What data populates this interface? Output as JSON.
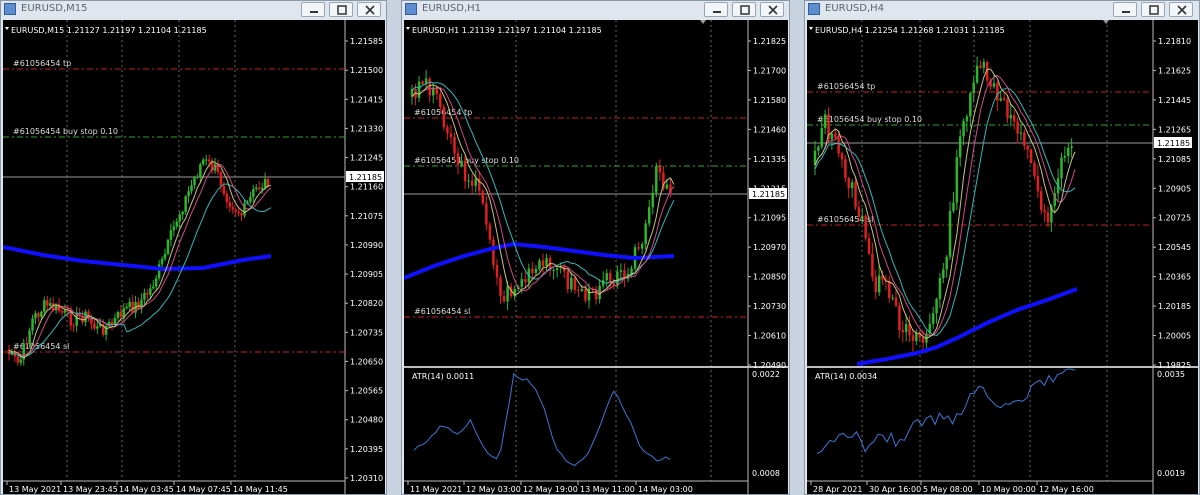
{
  "colors": {
    "bull": "#2db52d",
    "bear": "#e02020",
    "ma_blue": "#1010ff",
    "ma_cyan": "#2fb8b8",
    "ma_pink": "#d04a8a",
    "ma_yellow": "#c8c47a",
    "tp": "#c82020",
    "stop": "#2aa82a",
    "price": "#9a9a9a",
    "atr": "#3a78d8"
  },
  "windows": [
    {
      "id": "m15",
      "title": "EURUSD,M15",
      "header": "EURUSD,M15  1.21127 1.21197 1.21104 1.21185",
      "price_tag": "1.21185",
      "y_ticks": [
        "1.21585",
        "1.21500",
        "1.21415",
        "1.21330",
        "1.21245",
        "1.21160",
        "1.21075",
        "1.20990",
        "1.20905",
        "1.20820",
        "1.20735",
        "1.20650",
        "1.20565",
        "1.20480",
        "1.20395",
        "1.20310"
      ],
      "x_ticks": [
        "13 May 2021",
        "13 May 23:45",
        "14 May 03:45",
        "14 May 07:45",
        "14 May 11:45"
      ],
      "lines": [
        {
          "label": "#61056454 tp",
          "color": "tp"
        },
        {
          "label": "#61056454 buy stop 0.10",
          "color": "stop"
        },
        {
          "label": "#61056454 sl",
          "color": "tp"
        }
      ]
    },
    {
      "id": "h1",
      "title": "EURUSD,H1",
      "header": "EURUSD,H1  1.21139 1.21197 1.21104 1.21185",
      "price_tag": "1.21185",
      "y_ticks": [
        "1.21825",
        "1.21700",
        "1.21580",
        "1.21460",
        "1.21335",
        "1.21215",
        "1.21095",
        "1.20970",
        "1.20850",
        "1.20730",
        "1.20610",
        "1.20490"
      ],
      "atr_label": "ATR(14) 0.0011",
      "atr_ticks": [
        "0.0022",
        "0.0008"
      ],
      "x_ticks": [
        "11 May 2021",
        "12 May 03:00",
        "12 May 19:00",
        "13 May 11:00",
        "14 May 03:00"
      ],
      "lines": [
        {
          "label": "#61056454 tp",
          "color": "tp"
        },
        {
          "label": "#61056454 buy stop 0.10",
          "color": "stop"
        },
        {
          "label": "#61056454 sl",
          "color": "tp"
        }
      ]
    },
    {
      "id": "h4",
      "title": "EURUSD,H4",
      "header": "EURUSD,H4  1.21254 1.21268 1.21031 1.21185",
      "price_tag": "1.21185",
      "y_ticks": [
        "1.21810",
        "1.21625",
        "1.21445",
        "1.21265",
        "1.21085",
        "1.20905",
        "1.20725",
        "1.20545",
        "1.20365",
        "1.20185",
        "1.20005",
        "1.19825"
      ],
      "atr_label": "ATR(14) 0.0034",
      "atr_ticks": [
        "0.0035",
        "0.0019"
      ],
      "x_ticks": [
        "28 Apr 2021",
        "30 Apr 16:00",
        "5 May 08:00",
        "10 May 00:00",
        "12 May 16:00"
      ],
      "lines": [
        {
          "label": "#61056454 tp",
          "color": "tp"
        },
        {
          "label": "#61056454 buy stop 0.10",
          "color": "stop"
        },
        {
          "label": "#61056454 sl",
          "color": "tp"
        }
      ]
    }
  ]
}
